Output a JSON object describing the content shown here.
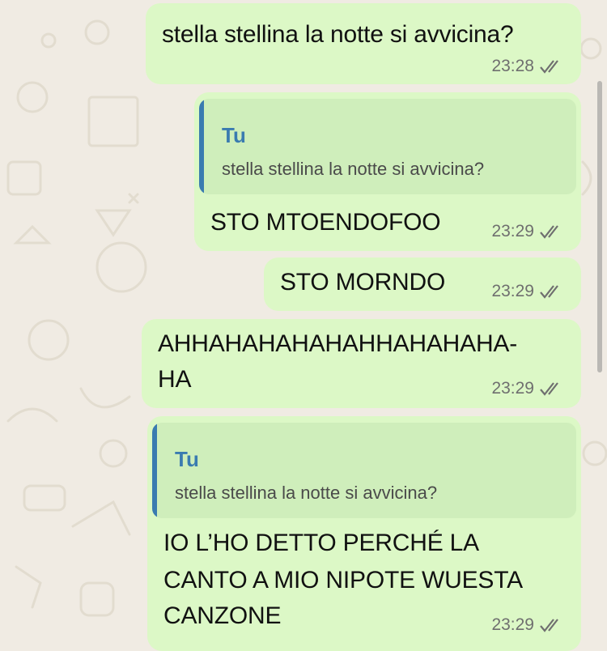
{
  "messages": [
    {
      "text": "stella stellina la notte si avvicina?",
      "time": "23:28",
      "status": "read"
    },
    {
      "quote": {
        "author": "Tu",
        "text": "stella stellina la notte si avvicina?"
      },
      "text": "STO MTOENDOFOO",
      "time": "23:29",
      "status": "read"
    },
    {
      "text": "STO MORNDO",
      "time": "23:29",
      "status": "read"
    },
    {
      "lines": [
        "AHHAHAHAHAHAHHAHAHAHA-",
        "HA"
      ],
      "time": "23:29",
      "status": "read"
    },
    {
      "quote": {
        "author": "Tu",
        "text": "stella stellina la notte si avvicina?"
      },
      "lines": [
        "IO L’HO DETTO PERCHÉ LA",
        "CANTO A MIO NIPOTE WUESTA",
        "CANZONE"
      ],
      "time": "23:29",
      "status": "read"
    }
  ],
  "theme": {
    "bubble_color": "#dcf8c6",
    "quote_bar_color": "#3a7bb0",
    "wallpaper_color": "#f0ebe3"
  }
}
